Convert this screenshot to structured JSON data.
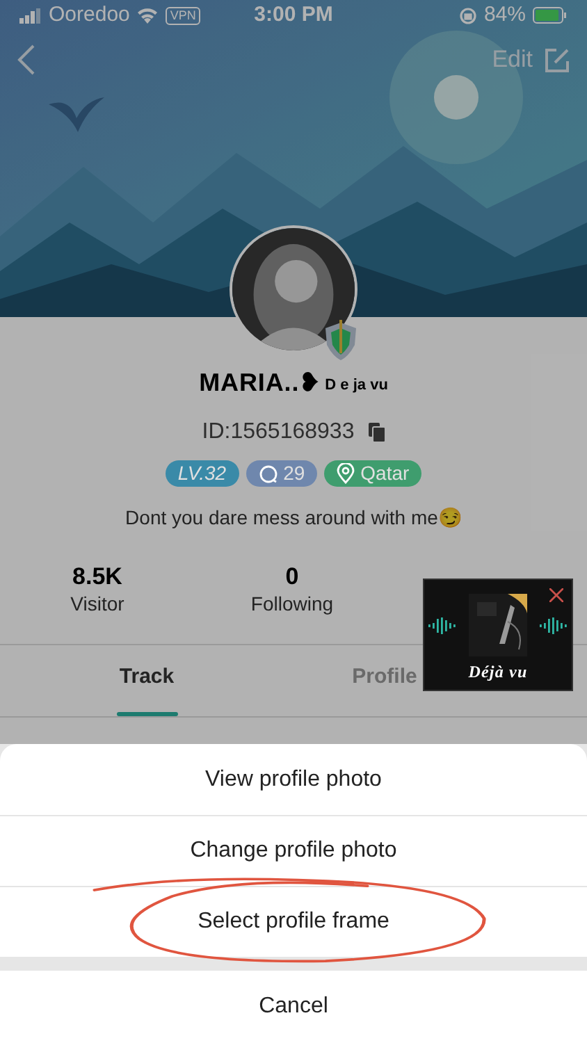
{
  "status_bar": {
    "carrier": "Ooredoo",
    "vpn": "VPN",
    "time": "3:00 PM",
    "battery": "84%"
  },
  "header": {
    "edit": "Edit"
  },
  "profile": {
    "name": "MARIA..❥",
    "name_suffix": "D e ja vu",
    "id": "ID:1565168933",
    "badges": [
      {
        "kind": "level",
        "text": "LV.32",
        "color": "#3a8aa8"
      },
      {
        "kind": "comments",
        "text": "29",
        "color": "#6f87ad"
      },
      {
        "kind": "location",
        "text": "Qatar",
        "color": "#3f9d6e"
      }
    ],
    "bio": "Dont you dare mess around with me😏"
  },
  "stats": [
    {
      "value": "8.5K",
      "label": "Visitor"
    },
    {
      "value": "0",
      "label": "Following"
    }
  ],
  "tabs": [
    {
      "label": "Track",
      "selected": true
    },
    {
      "label": "Profile",
      "selected": false
    }
  ],
  "music_widget": {
    "title": "Déjà vu"
  },
  "action_sheet": {
    "options": [
      "View profile photo",
      "Change profile photo",
      "Select profile frame"
    ],
    "cancel": "Cancel"
  }
}
